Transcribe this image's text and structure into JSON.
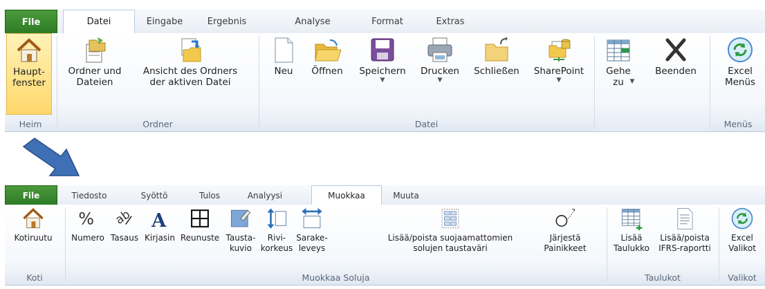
{
  "top": {
    "tabs": [
      "File",
      "Datei",
      "Eingabe",
      "Ergebnis",
      "Analyse",
      "Format",
      "Extras"
    ],
    "buttons": {
      "haupt": "Haupt-\nfenster",
      "ordner": "Ordner und\nDateien",
      "ansicht": "Ansicht des Ordners\nder aktiven Datei",
      "neu": "Neu",
      "oeffnen": "Öffnen",
      "speichern": "Speichern",
      "drucken": "Drucken",
      "schliessen": "Schließen",
      "sharepoint": "SharePoint",
      "gehe": "Gehe\nzu",
      "beenden": "Beenden",
      "excel": "Excel\nMenüs"
    },
    "groups": {
      "heim": "Heim",
      "ordner": "Ordner",
      "datei": "Datei",
      "menus": "Menüs"
    }
  },
  "bottom": {
    "tabs": [
      "File",
      "Tiedosto",
      "Syöttö",
      "Tulos",
      "Analyysi",
      "Muokkaa",
      "Muuta"
    ],
    "buttons": {
      "kotiruutu": "Kotiruutu",
      "numero": "Numero",
      "tasaus": "Tasaus",
      "kirjasin": "Kirjasin",
      "reunuste": "Reunuste",
      "taustakuvio": "Tausta-\nkuvio",
      "rivikorkeus": "Rivi-\nkorkeus",
      "sarakeleveys": "Sarake-\nleveys",
      "lisaapoista": "Lisää/poista suojaamattomien\nsolujen taustaväri",
      "jarjesta": "Järjestä\nPainikkeet",
      "lisaataulukko": "Lisää\nTaulukko",
      "ifrs": "Lisää/poista\nIFRS-raportti",
      "excel": "Excel\nValikot"
    },
    "groups": {
      "koti": "Koti",
      "muokkaa": "Muokkaa Soluja",
      "taulukot": "Taulukot",
      "valikot": "Valikot"
    }
  },
  "icons": {
    "arrow": "arrow-down-right-icon"
  },
  "colors": {
    "file_tab": "#3c8a30",
    "arrow": "#3f6fb5",
    "highlight": "#ffd86b"
  }
}
